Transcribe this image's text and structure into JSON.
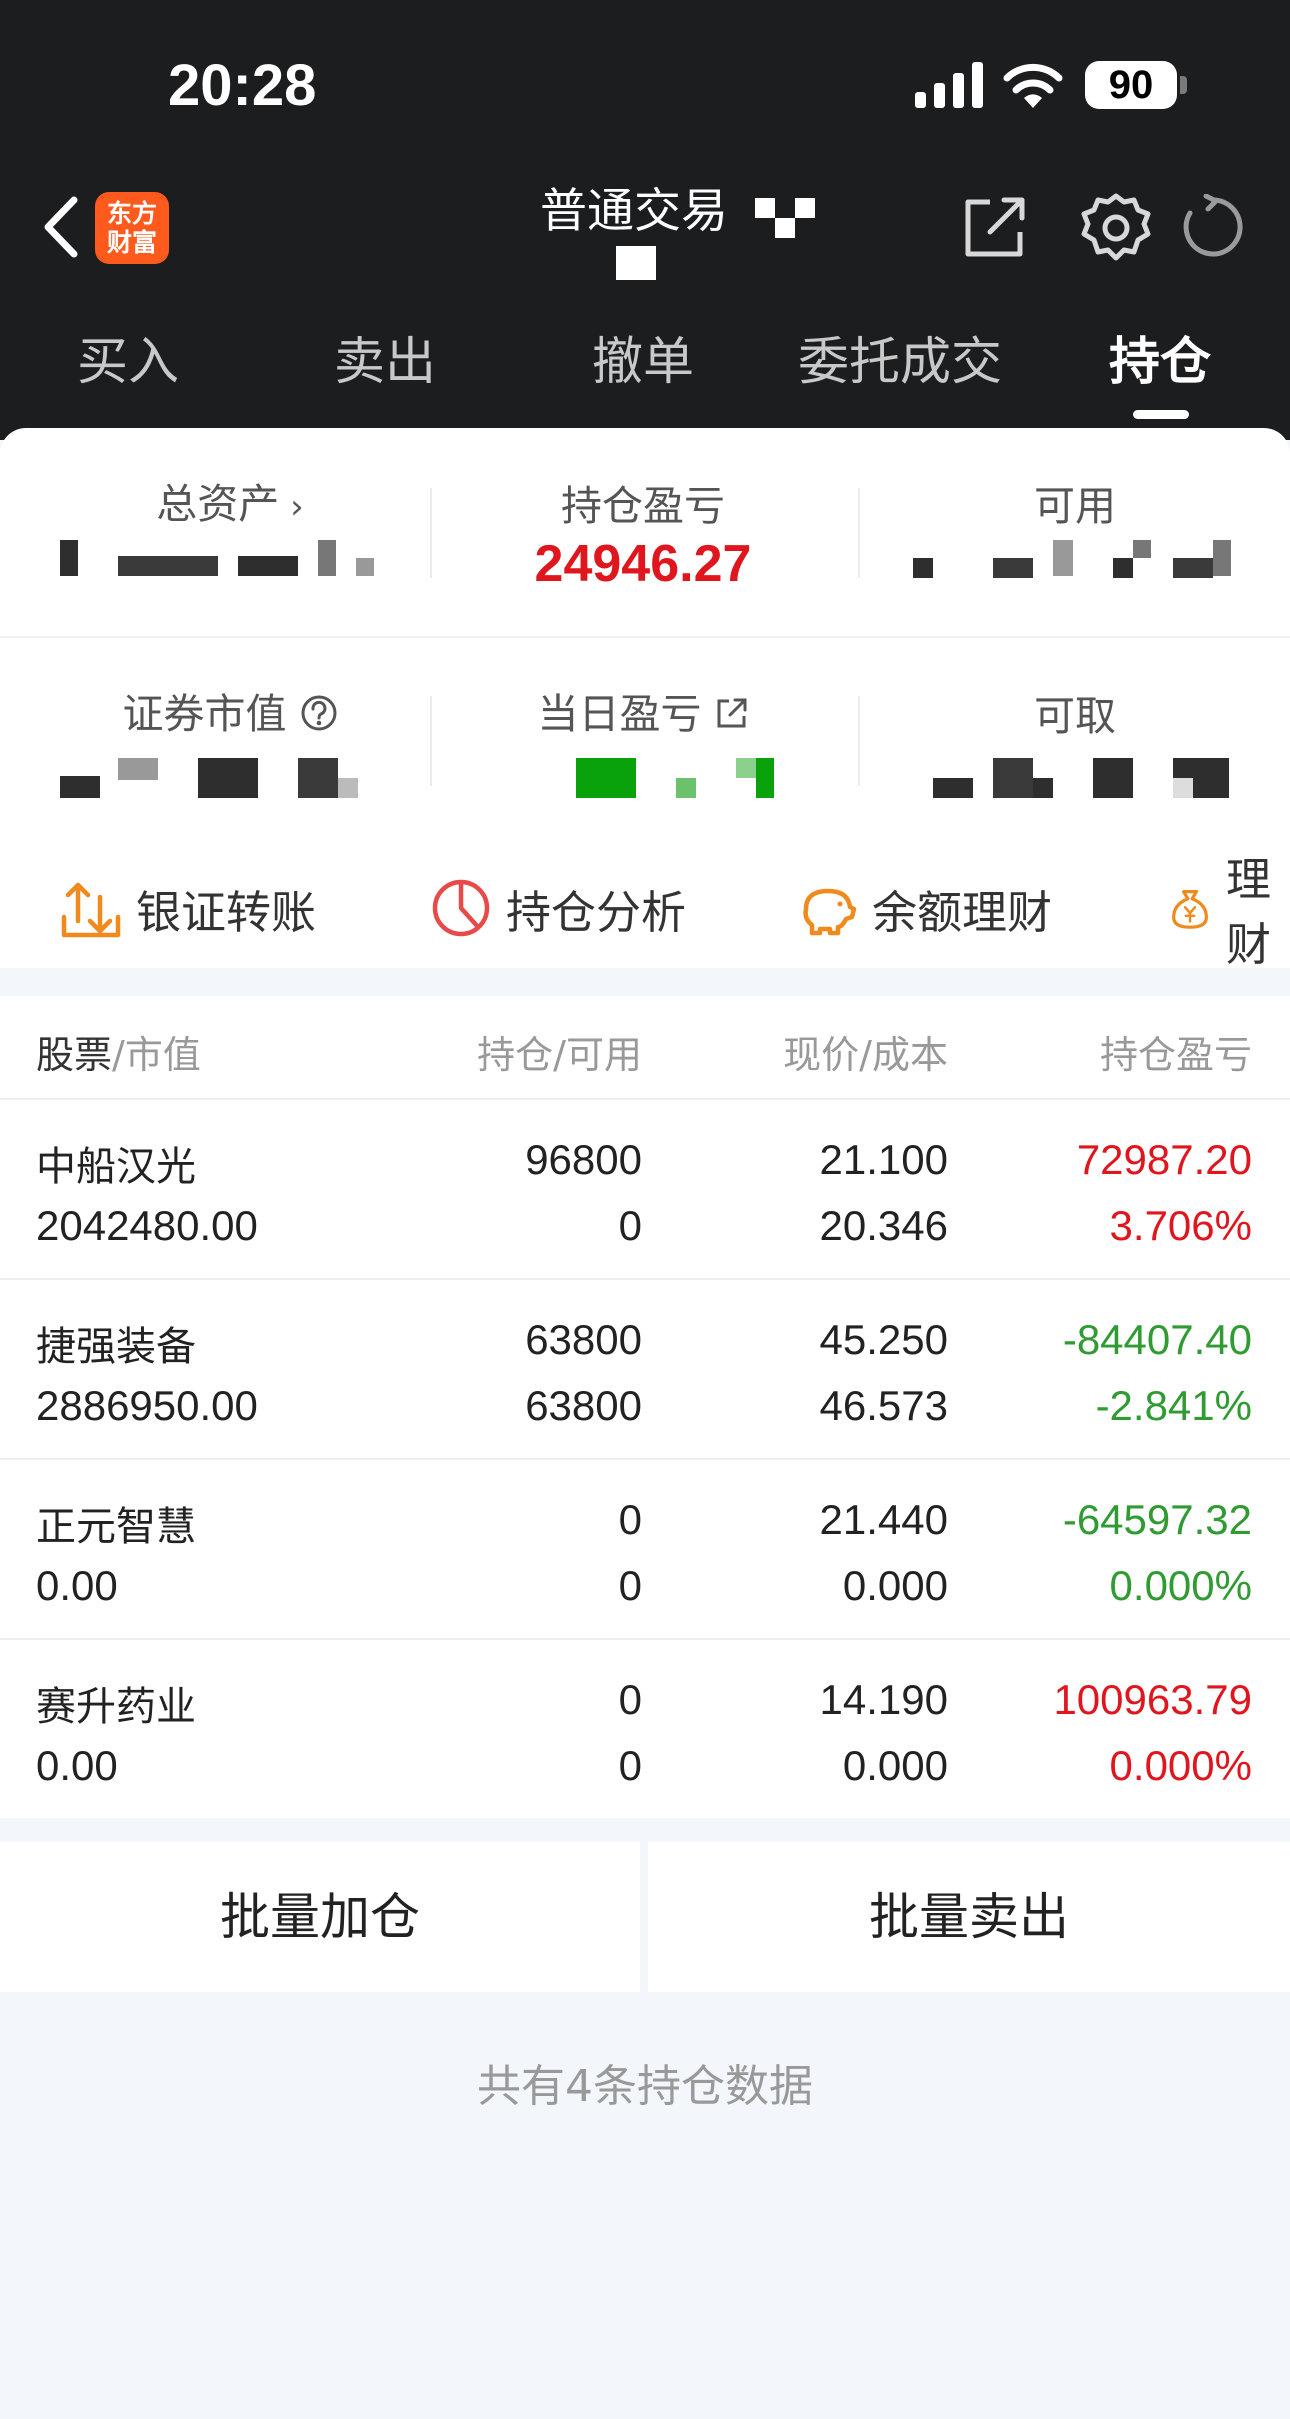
{
  "status_bar": {
    "time": "20:28",
    "battery": "90"
  },
  "header": {
    "logo_text_1": "东方",
    "logo_text_2": "财富",
    "title": "普通交易"
  },
  "tabs": [
    {
      "label": "买入"
    },
    {
      "label": "卖出"
    },
    {
      "label": "撤单"
    },
    {
      "label": "委托成交"
    },
    {
      "label": "持仓"
    }
  ],
  "summary": {
    "total_assets_label": "总资产",
    "position_pl_label": "持仓盈亏",
    "position_pl_value": "24946.27",
    "available_label": "可用",
    "market_value_label": "证券市值",
    "daily_pl_label": "当日盈亏",
    "withdrawable_label": "可取"
  },
  "quick_actions": [
    {
      "label": "银证转账",
      "icon": "transfer-icon"
    },
    {
      "label": "持仓分析",
      "icon": "pie-chart-icon"
    },
    {
      "label": "余额理财",
      "icon": "piggy-bank-icon"
    },
    {
      "label": "理财",
      "icon": "money-bag-icon"
    }
  ],
  "table": {
    "headers": {
      "stock": "股票",
      "market_value": "市值",
      "position": "持仓",
      "available": "可用",
      "price": "现价",
      "cost": "成本",
      "pl": "持仓盈亏"
    },
    "rows": [
      {
        "name": "中船汉光",
        "market_value": "2042480.00",
        "position": "96800",
        "available": "0",
        "price": "21.100",
        "cost": "20.346",
        "pl": "72987.20",
        "pl_pct": "3.706%",
        "trend": "up"
      },
      {
        "name": "捷强装备",
        "market_value": "2886950.00",
        "position": "63800",
        "available": "63800",
        "price": "45.250",
        "cost": "46.573",
        "pl": "-84407.40",
        "pl_pct": "-2.841%",
        "trend": "down"
      },
      {
        "name": "正元智慧",
        "market_value": "0.00",
        "position": "0",
        "available": "0",
        "price": "21.440",
        "cost": "0.000",
        "pl": "-64597.32",
        "pl_pct": "0.000%",
        "trend": "down"
      },
      {
        "name": "赛升药业",
        "market_value": "0.00",
        "position": "0",
        "available": "0",
        "price": "14.190",
        "cost": "0.000",
        "pl": "100963.79",
        "pl_pct": "0.000%",
        "trend": "up"
      }
    ]
  },
  "batch_actions": {
    "add": "批量加仓",
    "sell": "批量卖出"
  },
  "footer_note": "共有4条持仓数据",
  "colors": {
    "up": "#e0161e",
    "down": "#2f9b32",
    "brand": "#ff5a1d",
    "header_bg": "#1c1d1f"
  }
}
